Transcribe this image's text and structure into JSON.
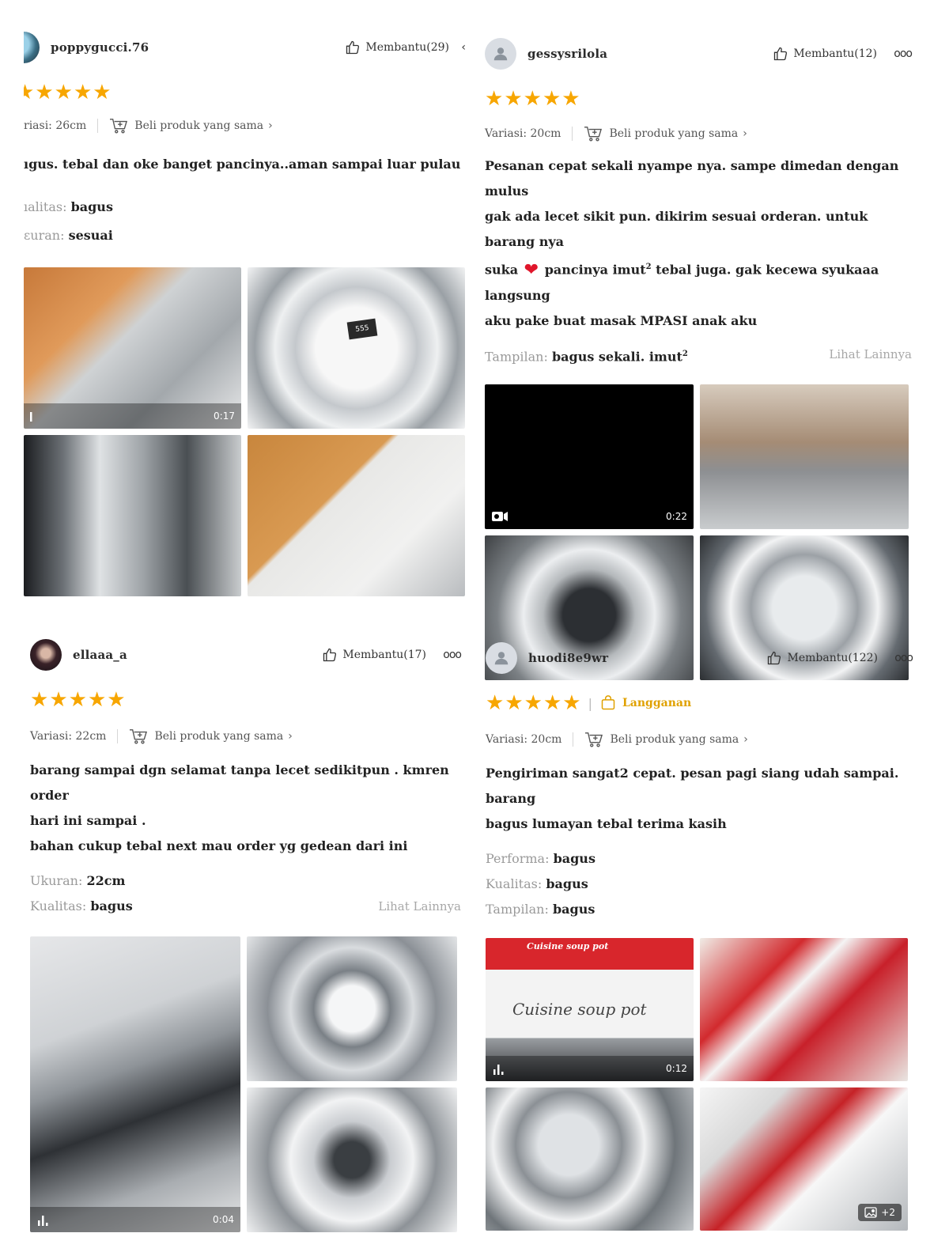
{
  "reviews": [
    {
      "username": "poppygucci.76",
      "helpful": "Membantu(29)",
      "more": "‹",
      "stars": 5,
      "variation": "riasi: 26cm",
      "buy_same": "Beli produk yang sama",
      "text_lines": [
        "ıgus. tebal dan oke banget pancinya..aman sampai luar pulau"
      ],
      "attributes": [
        {
          "key": "ıalitas:",
          "value": "bagus"
        },
        {
          "key": "ɛuran:",
          "value": "sesuai"
        }
      ],
      "media": [
        {
          "kind": "video",
          "duration": "0:17"
        },
        {
          "kind": "photo",
          "label": "555"
        },
        {
          "kind": "photo"
        },
        {
          "kind": "photo"
        }
      ]
    },
    {
      "username": "gessysrilola",
      "helpful": "Membantu(12)",
      "more": "ooo",
      "stars": 5,
      "variation": "Variasi: 20cm",
      "buy_same": "Beli produk yang sama",
      "text_lines": [
        "Pesanan cepat sekali nyampe nya. sampe dimedan dengan mulus",
        "gak ada lecet sikit pun. dikirim sesuai orderan. untuk barang nya",
        "suka",
        "pancinya imut",
        "2",
        "tebal juga. gak kecewa syukaaa langsung",
        "aku pake buat masak MPASI anak aku"
      ],
      "heart": "❤",
      "attributes": [
        {
          "key": "Tampilan:",
          "value": "bagus sekali. imut",
          "sup": "2"
        }
      ],
      "see_more": "Lihat Lainnya",
      "media": [
        {
          "kind": "video",
          "duration": "0:22"
        },
        {
          "kind": "photo"
        },
        {
          "kind": "photo"
        },
        {
          "kind": "photo"
        }
      ]
    },
    {
      "username": "ellaaa_a",
      "helpful": "Membantu(17)",
      "more": "ooo",
      "stars": 5,
      "variation": "Variasi: 22cm",
      "buy_same": "Beli produk yang sama",
      "text_lines": [
        "barang sampai dgn selamat tanpa lecet sedikitpun . kmren order",
        "hari ini sampai .",
        "bahan cukup tebal next mau order yg gedean dari ini"
      ],
      "attributes": [
        {
          "key": "Ukuran:",
          "value": "22cm"
        },
        {
          "key": "Kualitas:",
          "value": "bagus"
        }
      ],
      "see_more": "Lihat Lainnya",
      "media": [
        {
          "kind": "video",
          "duration": "0:04"
        },
        {
          "kind": "photo"
        },
        {
          "kind": "photo"
        }
      ]
    },
    {
      "username": "huodi8e9wr",
      "helpful": "Membantu(122)",
      "more": "ooo",
      "stars": 5,
      "badge": "Langganan",
      "variation": "Variasi: 20cm",
      "buy_same": "Beli produk yang sama",
      "text_lines": [
        "Pengiriman sangat2 cepat. pesan pagi siang udah sampai. barang",
        "bagus lumayan tebal terima kasih"
      ],
      "attributes": [
        {
          "key": "Performa:",
          "value": "bagus"
        },
        {
          "key": "Kualitas:",
          "value": "bagus"
        },
        {
          "key": "Tampilan:",
          "value": "bagus"
        }
      ],
      "media": [
        {
          "kind": "video",
          "duration": "0:12",
          "box_title": "Cuisine soup pot",
          "box_top": "Cuisine soup pot"
        },
        {
          "kind": "photo"
        },
        {
          "kind": "photo"
        },
        {
          "kind": "photo",
          "more_count": "+2"
        }
      ]
    }
  ],
  "colors": {
    "star": "#f7a600",
    "subscription": "#e0a100",
    "heart": "#e0162b",
    "muted": "#9a9a9a"
  },
  "icons": {
    "helpful": "thumbs-up-icon",
    "cart": "cart-plus-icon",
    "avatar_default": "user-icon",
    "subscription": "shopping-bag-icon",
    "video": "video-icon",
    "gallery": "image-icon"
  }
}
